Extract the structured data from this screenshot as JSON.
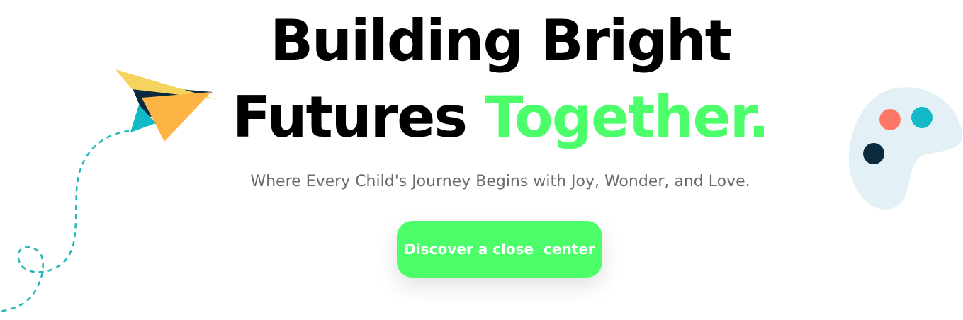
{
  "hero": {
    "headline_line1": "Building Bright",
    "headline_line2_plain": "Futures ",
    "headline_line2_accent": "Together.",
    "subtitle": "Where Every Child's Journey Begins with Joy, Wonder, and Love.",
    "cta_label": "Discover a close  center"
  },
  "decorations": {
    "left": "paper-plane-kite-icon",
    "right": "paint-palette-icon"
  },
  "colors": {
    "accent": "#4cff6a",
    "headline": "#000000",
    "subtitle": "#6b6b6b",
    "dashed_path": "#1fb8b6",
    "kite_yellow": "#f5d45e",
    "kite_orange": "#fdb444",
    "kite_navy": "#0b2a3e",
    "kite_teal": "#12b9c6",
    "palette_bg": "#e3f1f7",
    "dot_coral": "#ff7766",
    "dot_teal": "#12b9c6",
    "dot_navy": "#0b2a3e"
  }
}
